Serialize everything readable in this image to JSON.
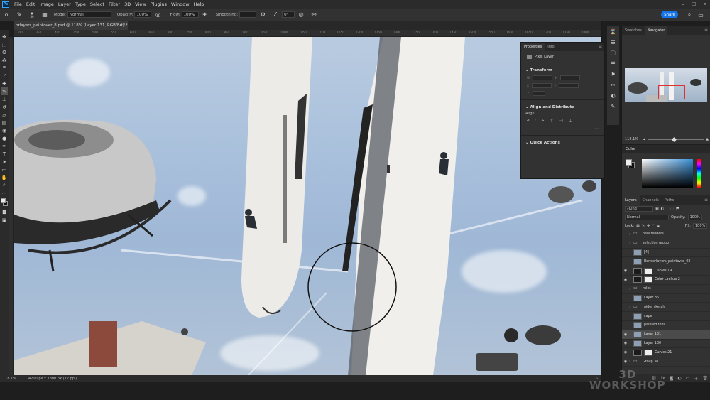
{
  "app": {
    "logo": "Ps"
  },
  "menu": [
    "File",
    "Edit",
    "Image",
    "Layer",
    "Type",
    "Select",
    "Filter",
    "3D",
    "View",
    "Plugins",
    "Window",
    "Help"
  ],
  "options": {
    "mode_label": "Mode:",
    "mode_value": "Normal",
    "opacity_label": "Opacity:",
    "opacity_value": "100%",
    "flow_label": "Flow:",
    "flow_value": "100%",
    "smoothing_label": "Smoothing:",
    "angle_value": "0°",
    "brush_size": "30",
    "share_label": "Share"
  },
  "document": {
    "tab_title": "nrlayers_paintover_8.psd @ 118% (Layer 131, RGB/8#) *",
    "ruler_ticks": [
      "300",
      "350",
      "400",
      "450",
      "500",
      "550",
      "600",
      "650",
      "700",
      "750",
      "800",
      "850",
      "900",
      "950",
      "1000",
      "1050",
      "1100",
      "1150",
      "1200",
      "1250",
      "1300",
      "1350",
      "1400",
      "1450",
      "1500",
      "1550",
      "1600",
      "1650",
      "1700",
      "1750",
      "1800"
    ]
  },
  "status": {
    "zoom": "118.1%",
    "doc_info": "4200 px x 1800 px (72 ppi)"
  },
  "properties": {
    "tabs": [
      "Properties",
      "Info"
    ],
    "layer_kind": "Pixel Layer",
    "transform_label": "Transform",
    "align_label": "Align and Distribute",
    "align_sub": "Align:",
    "quick_actions_label": "Quick Actions"
  },
  "navigator": {
    "tabs": [
      "Swatches",
      "Navigator"
    ],
    "zoom": "118.1%"
  },
  "color_panel": {
    "title": "Color"
  },
  "layers_panel": {
    "tabs": [
      "Layers",
      "Channels",
      "Paths"
    ],
    "kind_label": "Kind",
    "blend_mode": "Normal",
    "opacity_label": "Opacity:",
    "opacity_value": "100%",
    "lock_label": "Lock:",
    "fill_label": "Fill:",
    "fill_value": "100%",
    "layers": [
      {
        "name": "new renders",
        "type": "folder",
        "visible": false,
        "selected": false
      },
      {
        "name": "selection group",
        "type": "folder",
        "visible": false,
        "selected": false
      },
      {
        "name": "[4]",
        "type": "pixel",
        "visible": false,
        "selected": false
      },
      {
        "name": "Renderlayers_paintover_02",
        "type": "pixel",
        "visible": false,
        "selected": false
      },
      {
        "name": "Curves 19",
        "type": "adjust",
        "visible": true,
        "selected": false
      },
      {
        "name": "Color Lookup 2",
        "type": "adjust",
        "visible": true,
        "selected": false
      },
      {
        "name": "rules",
        "type": "folder",
        "visible": false,
        "selected": false
      },
      {
        "name": "Layer 85",
        "type": "pixel",
        "visible": false,
        "selected": false
      },
      {
        "name": "raider sketch",
        "type": "folder",
        "visible": false,
        "selected": false
      },
      {
        "name": "cape",
        "type": "pixel",
        "visible": false,
        "selected": false
      },
      {
        "name": "painted tedl",
        "type": "pixel",
        "visible": false,
        "selected": false
      },
      {
        "name": "Layer 131",
        "type": "pixel",
        "visible": true,
        "selected": true
      },
      {
        "name": "Layer 130",
        "type": "pixel",
        "visible": true,
        "selected": false
      },
      {
        "name": "Curves 21",
        "type": "adjust",
        "visible": true,
        "selected": false
      },
      {
        "name": "Group 38",
        "type": "folder",
        "visible": true,
        "selected": false
      }
    ]
  },
  "watermark": {
    "line1": "3D",
    "line2": "WORKSHOP"
  }
}
